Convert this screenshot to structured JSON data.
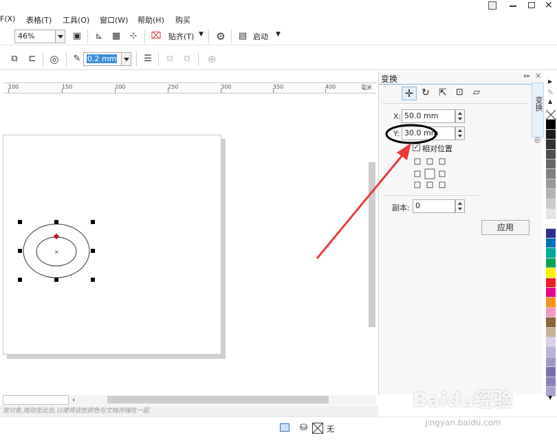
{
  "menu": {
    "items": [
      "F(X)",
      "表格(T)",
      "工具(O)",
      "窗口(W)",
      "帮助(H)",
      "购买"
    ]
  },
  "toolbar": {
    "zoom_value": "46%",
    "snap_label": "贴齐(T)",
    "launch_label": "启动",
    "outline_width_value": "0.2 mm"
  },
  "ruler": {
    "labels": [
      "100",
      "150",
      "200",
      "250",
      "300",
      "350",
      "400",
      "毫米"
    ]
  },
  "docker": {
    "title": "变换",
    "x_label": "X:",
    "x_value": "50.0 mm",
    "y_label": "Y:",
    "y_value": "30.0 mm",
    "relative_label": "相对位置",
    "relative_checked": true,
    "copies_label": "副本:",
    "copies_value": "0",
    "apply_label": "应用",
    "side_tab_label": "变换"
  },
  "status": {
    "hint_text": "放对象,拖动至此处,以便将这些颜色与文档存储在一起",
    "fill_none_label": "无"
  },
  "watermark": {
    "brand": "Baidu经验",
    "url": "jingyan.baidu.com"
  },
  "colors": {
    "annotation_arrow": "#ea3a3a",
    "ellipse_stroke": "#333333",
    "accent": "#3c8ddc"
  },
  "palette": [
    "#ffffff",
    "#000000",
    "#1a1a1a",
    "#333333",
    "#4d4d4d",
    "#666666",
    "#808080",
    "#999999",
    "#b3b3b3",
    "#cccccc",
    "#e6e6e6",
    "#ffffff",
    "#2e3192",
    "#0072bc",
    "#00a99d",
    "#00a651",
    "#fff200",
    "#ed1c24",
    "#ec008c",
    "#f7941d",
    "#f49ac1",
    "#8c6239",
    "#c7b299",
    "#d8d0e8",
    "#b9b3da",
    "#9e9ac8",
    "#7a6fb0",
    "#8881b8",
    "#a7a3d1"
  ]
}
